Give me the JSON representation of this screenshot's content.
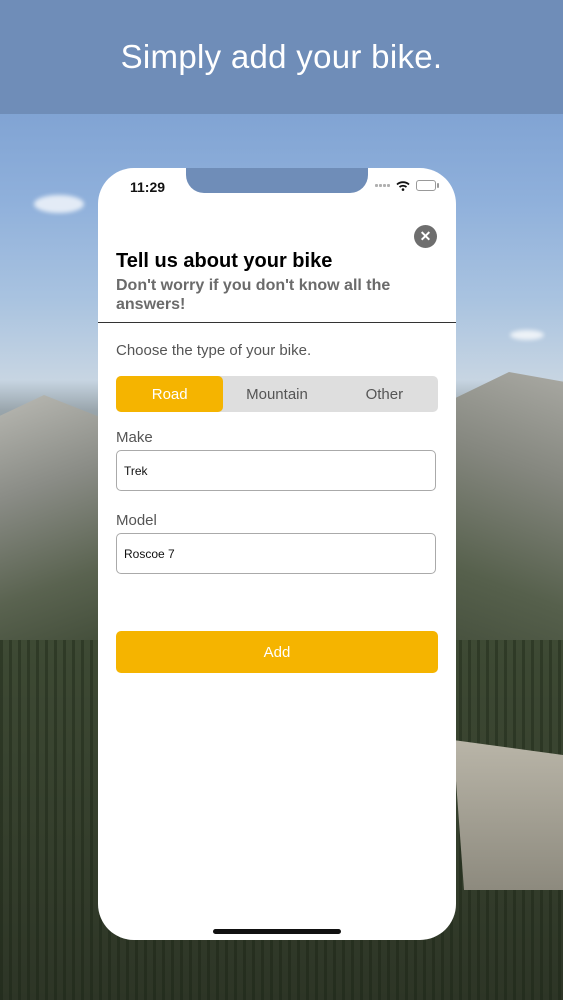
{
  "banner": {
    "title": "Simply add your bike."
  },
  "status": {
    "time": "11:29"
  },
  "form": {
    "title": "Tell us about your bike",
    "subtitle": "Don't worry if you don't know all the answers!",
    "type_prompt": "Choose the type of your bike.",
    "types": [
      {
        "label": "Road",
        "selected": true
      },
      {
        "label": "Mountain",
        "selected": false
      },
      {
        "label": "Other",
        "selected": false
      }
    ],
    "make_label": "Make",
    "make_value": "Trek",
    "model_label": "Model",
    "model_value": "Roscoe 7",
    "add_label": "Add"
  },
  "icons": {
    "close": "close-icon",
    "wifi": "wifi-icon",
    "battery": "battery-icon",
    "signal": "signal-icon"
  },
  "colors": {
    "accent": "#f5b400",
    "banner": "#6f8db8",
    "segment_bg": "#dedede"
  }
}
